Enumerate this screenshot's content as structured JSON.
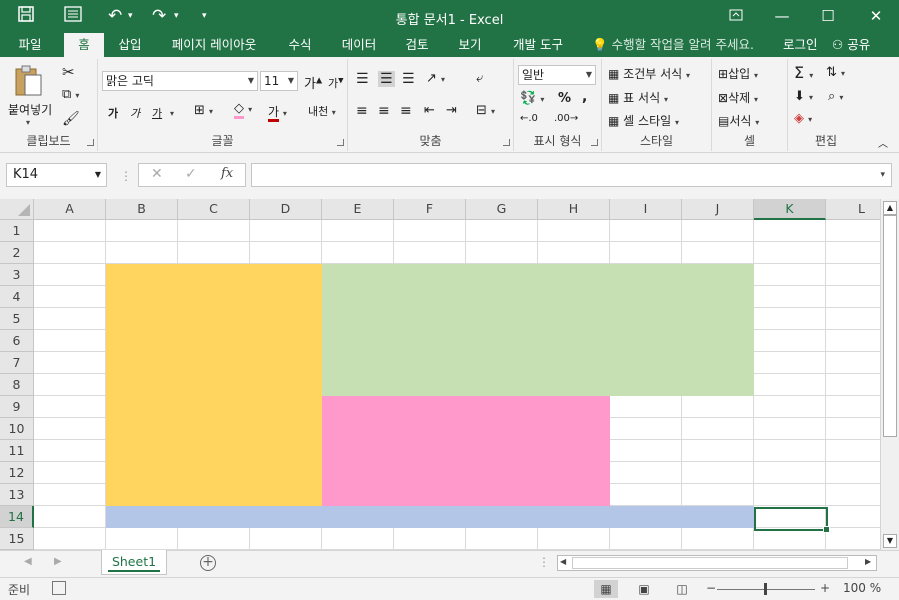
{
  "titlebar": {
    "title": "통합 문서1 - Excel",
    "save_icon": "save-icon",
    "undo_icon": "undo-icon",
    "redo_icon": "redo-icon",
    "bg_color": "#217346"
  },
  "tabs": [
    {
      "label": "파일"
    },
    {
      "label": "홈"
    },
    {
      "label": "삽입"
    },
    {
      "label": "페이지 레이아웃"
    },
    {
      "label": "수식"
    },
    {
      "label": "데이터"
    },
    {
      "label": "검토"
    },
    {
      "label": "보기"
    },
    {
      "label": "개발 도구"
    }
  ],
  "tell_me": "수행할 작업을 알려 주세요.",
  "login": "로그인",
  "share": "공유",
  "ribbon": {
    "clipboard": {
      "label": "클립보드",
      "paste": "붙여넣기"
    },
    "font": {
      "label": "글꼴",
      "font_name": "맑은 고딕",
      "font_size": "11",
      "grow": "가",
      "bold": "가",
      "italic": "가",
      "underline": "가",
      "font_color": "가",
      "phonetic": "내천"
    },
    "alignment": {
      "label": "맞춤"
    },
    "number": {
      "label": "표시 형식",
      "format": "일반",
      "percent": "%",
      "comma": ","
    },
    "styles": {
      "label": "스타일",
      "conditional": "조건부 서식",
      "table": "표 서식",
      "cell_styles": "셀 스타일"
    },
    "cells": {
      "label": "셀",
      "insert": "삽입",
      "delete": "삭제",
      "format": "서식"
    },
    "editing": {
      "label": "편집"
    }
  },
  "formula_bar": {
    "name_box": "K14",
    "fx": "fx",
    "value": ""
  },
  "grid": {
    "columns": [
      "A",
      "B",
      "C",
      "D",
      "E",
      "F",
      "G",
      "H",
      "I",
      "J",
      "K",
      "L"
    ],
    "rows": [
      "1",
      "2",
      "3",
      "4",
      "5",
      "6",
      "7",
      "8",
      "9",
      "10",
      "11",
      "12",
      "13",
      "14",
      "15"
    ],
    "selected_col": "K",
    "selected_row": "14",
    "fills": [
      {
        "name": "fill-yellow-b3-d13",
        "range": "B3:D13",
        "color": "#ffd55f"
      },
      {
        "name": "fill-green-e3-j8",
        "range": "E3:J8",
        "color": "#c6e0b4"
      },
      {
        "name": "fill-pink-e9-h13",
        "range": "E9:H13",
        "color": "#ff99cc"
      },
      {
        "name": "fill-blue-b14-j14",
        "range": "B14:J14",
        "color": "#b4c6e7"
      }
    ]
  },
  "sheets": [
    {
      "label": "Sheet1",
      "active": true
    }
  ],
  "status": {
    "ready": "준비",
    "zoom": "100 %"
  }
}
